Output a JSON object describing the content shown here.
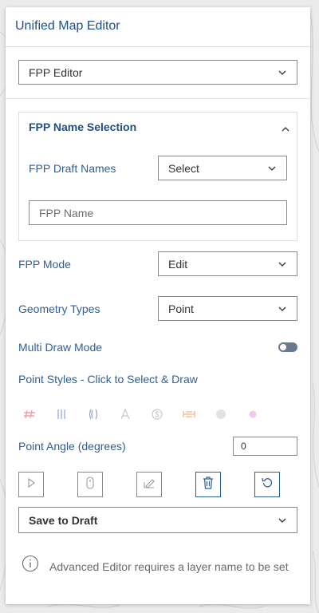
{
  "app": {
    "title": "Unified Map Editor"
  },
  "editor_select": {
    "value": "FPP Editor"
  },
  "name_section": {
    "title": "FPP Name Selection",
    "draft_names_label": "FPP Draft Names",
    "draft_names_value": "Select",
    "name_placeholder": "FPP Name"
  },
  "mode": {
    "label": "FPP Mode",
    "value": "Edit"
  },
  "geometry": {
    "label": "Geometry Types",
    "value": "Point"
  },
  "multi_draw": {
    "label": "Multi Draw Mode",
    "enabled": false
  },
  "point_styles": {
    "label": "Point Styles - Click to Select & Draw",
    "symbols": [
      {
        "icon": "hash-icon",
        "color": "#f4a0a6"
      },
      {
        "icon": "triple-bar-icon",
        "color": "#a9b7e6"
      },
      {
        "icon": "paren-pair-icon",
        "color": "#9aa6c8"
      },
      {
        "icon": "triangle-a-icon",
        "color": "#c8c8c8"
      },
      {
        "icon": "circled-s-icon",
        "color": "#c8c8c8"
      },
      {
        "icon": "bracket-bar-icon",
        "color": "#f2b48a"
      },
      {
        "icon": "gray-dot-icon",
        "color": "#e3e3e3"
      },
      {
        "icon": "magenta-dot-icon",
        "color": "#f7c6ec"
      }
    ]
  },
  "angle": {
    "label": "Point Angle (degrees)",
    "value": "0"
  },
  "tools": [
    {
      "icon": "cursor-arrow-icon"
    },
    {
      "icon": "mouse-icon"
    },
    {
      "icon": "edit-pencil-icon"
    },
    {
      "icon": "trash-icon"
    },
    {
      "icon": "undo-icon"
    }
  ],
  "save_select": {
    "value": "Save to Draft"
  },
  "info": {
    "icon": "info-icon",
    "message": "Advanced Editor requires a layer name to be set"
  },
  "colors": {
    "accent": "#2e5f96",
    "title": "#1e4f8a",
    "border": "#8a8a8a",
    "toggle_off": "#6a7a8e"
  }
}
